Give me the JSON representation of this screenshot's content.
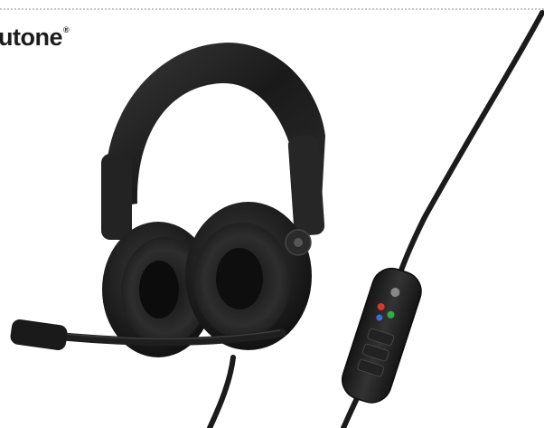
{
  "brand": {
    "name": "utone",
    "trademark": "®"
  },
  "product": {
    "subject": "headset-with-inline-controller",
    "icon": "headset-icon",
    "colors": {
      "body": "#1e1e1e",
      "cushion": "#2a2a2a",
      "highlight": "#4a4a4a",
      "led_red": "#d23a2a",
      "led_green": "#2fae4a",
      "led_blue": "#3a6fd8"
    }
  }
}
